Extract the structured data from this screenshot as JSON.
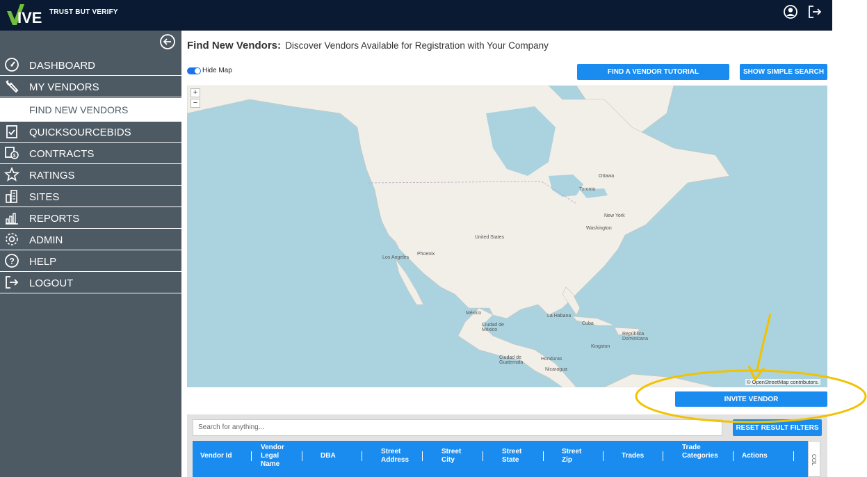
{
  "header": {
    "logo_text": "VIVE",
    "tagline": "TRUST BUT VERIFY",
    "icons": [
      "user-circle-icon",
      "logout-icon"
    ]
  },
  "sidebar": {
    "items": [
      {
        "label": "DASHBOARD",
        "icon": "dashboard-gauge-icon"
      },
      {
        "label": "MY VENDORS",
        "icon": "wrench-icon"
      },
      {
        "label": "FIND NEW VENDORS",
        "icon": ""
      },
      {
        "label": "QUICKSOURCEBIDS",
        "icon": "clipboard-check-icon"
      },
      {
        "label": "CONTRACTS",
        "icon": "contract-dollar-icon"
      },
      {
        "label": "RATINGS",
        "icon": "star-icon"
      },
      {
        "label": "SITES",
        "icon": "buildings-icon"
      },
      {
        "label": "REPORTS",
        "icon": "bar-chart-icon"
      },
      {
        "label": "ADMIN",
        "icon": "gear-icon"
      },
      {
        "label": "HELP",
        "icon": "question-circle-icon"
      },
      {
        "label": "LOGOUT",
        "icon": "logout-icon"
      }
    ]
  },
  "page": {
    "title": "Find New Vendors:",
    "subtitle": "Discover Vendors Available for Registration with Your Company"
  },
  "map_toggle": {
    "label": "Hide Map",
    "on": true
  },
  "buttons": {
    "tutorial": "FIND A VENDOR TUTORIAL",
    "simple_search": "SHOW SIMPLE SEARCH",
    "invite": "INVITE VENDOR",
    "reset_filters": "RESET RESULT FILTERS"
  },
  "map": {
    "zoom_in": "+",
    "zoom_out": "−",
    "attribution": "© OpenStreetMap contributors.",
    "labels": {
      "ottawa": "Ottawa",
      "toronto": "Toronto",
      "new_york": "New York",
      "washington": "Washington",
      "united_states": "United States",
      "los_angeles": "Los Angeles",
      "phoenix": "Phoenix",
      "mexico": "México",
      "ciudad_de_mexico": "Ciudad de México",
      "la_habana": "La Habana",
      "cuba": "Cuba",
      "republica_dominicana": "República Dominicana",
      "kingston": "Kingston",
      "ciudad_de_guatemala": "Ciudad de Guatemala",
      "honduras": "Honduras",
      "nicaragua": "Nicaragua"
    }
  },
  "search": {
    "placeholder": "Search for anything..."
  },
  "table": {
    "columns": [
      "Vendor Id",
      "Vendor Legal Name",
      "DBA",
      "Street Address",
      "Street City",
      "Street State",
      "Street Zip",
      "Trades",
      "Trade Categories",
      "Actions"
    ],
    "columns_toggle": "COL"
  },
  "colors": {
    "header_bg": "#0b1a33",
    "sidebar_bg": "#4e5a63",
    "accent": "#1a8cf0",
    "highlight_annotation": "#f2c200"
  }
}
